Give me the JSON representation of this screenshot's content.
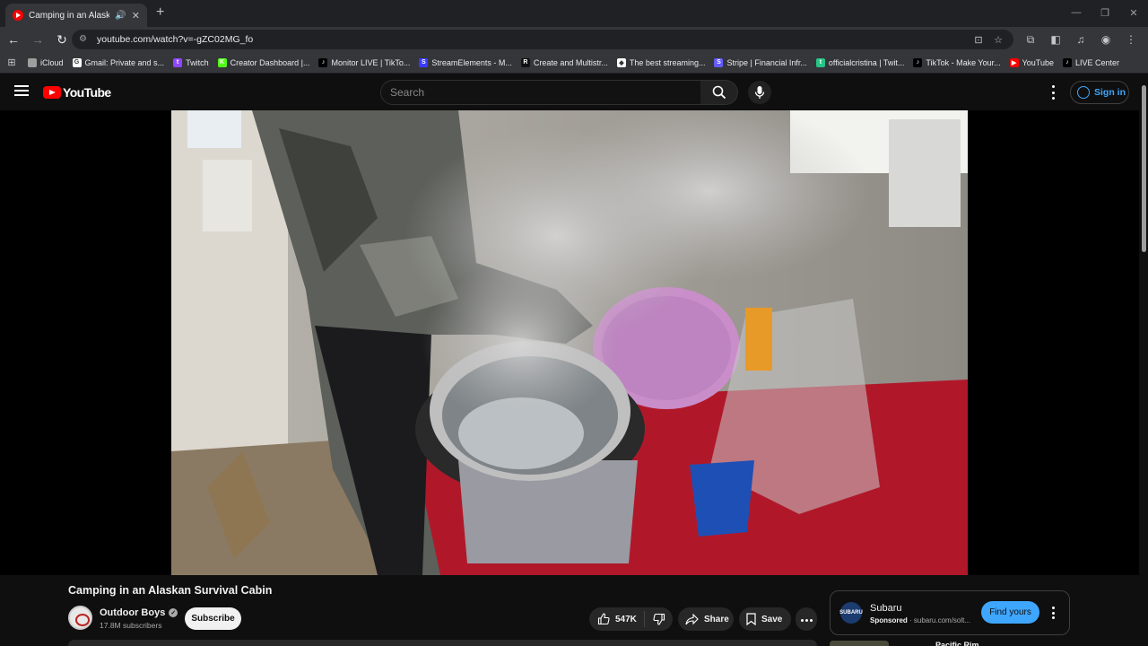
{
  "browser": {
    "tab": {
      "title": "Camping in an Alaskan Sur",
      "audio_icon": "speaker-icon",
      "close": "✕"
    },
    "new_tab": "+",
    "url": "youtube.com/watch?v=-gZC02MG_fo",
    "bookmarks": [
      {
        "label": "iCloud",
        "icon": "apple-icon",
        "color": "#9e9e9e",
        "glyph": ""
      },
      {
        "label": "Gmail: Private and s...",
        "icon": "google-icon",
        "color": "#ffffff",
        "glyph": "G"
      },
      {
        "label": "Twitch",
        "icon": "twitch-icon",
        "color": "#9146ff",
        "glyph": "t"
      },
      {
        "label": "Creator Dashboard |...",
        "icon": "kick-icon",
        "color": "#53fc18",
        "glyph": "K"
      },
      {
        "label": "Monitor LIVE | TikTo...",
        "icon": "tiktok-icon",
        "color": "#000000",
        "glyph": "♪"
      },
      {
        "label": "StreamElements - M...",
        "icon": "streamelements-icon",
        "color": "#3b3bff",
        "glyph": "S"
      },
      {
        "label": "Create and Multistr...",
        "icon": "restream-icon",
        "color": "#111111",
        "glyph": "R"
      },
      {
        "label": "The best streaming...",
        "icon": "diamond-icon",
        "color": "#ffffff",
        "glyph": "◆"
      },
      {
        "label": "Stripe | Financial Infr...",
        "icon": "stripe-icon",
        "color": "#635bff",
        "glyph": "S"
      },
      {
        "label": "officialcristina | Twit...",
        "icon": "twitch-green-icon",
        "color": "#26c485",
        "glyph": "t"
      },
      {
        "label": "TikTok - Make Your...",
        "icon": "tiktok-icon",
        "color": "#000000",
        "glyph": "♪"
      },
      {
        "label": "YouTube",
        "icon": "youtube-icon",
        "color": "#ff0000",
        "glyph": "▶"
      },
      {
        "label": "LIVE Center",
        "icon": "tiktok-icon",
        "color": "#000000",
        "glyph": "♪"
      }
    ]
  },
  "youtube": {
    "logo_text": "YouTube",
    "search_placeholder": "Search",
    "signin_label": "Sign in",
    "video": {
      "title": "Camping in an Alaskan Survival Cabin",
      "channel": "Outdoor Boys",
      "subscribers": "17.8M subscribers",
      "subscribe_label": "Subscribe",
      "likes": "547K",
      "share_label": "Share",
      "save_label": "Save"
    },
    "ad": {
      "advertiser": "Subaru",
      "logo_text": "SUBARU",
      "sponsored": "Sponsored",
      "domain": "subaru.com/solt...",
      "cta": "Find yours"
    },
    "next": {
      "title": "Pacific Rim"
    }
  }
}
